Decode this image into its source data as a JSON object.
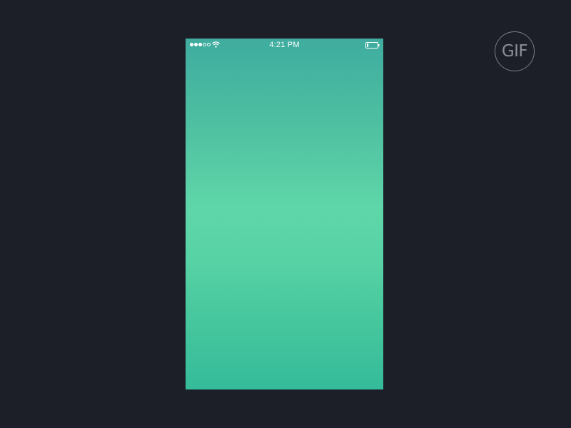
{
  "status_bar": {
    "time": "4:21 PM",
    "signal_bars_filled": 3,
    "signal_bars_total": 5,
    "wifi_icon": "wifi-icon",
    "battery_icon": "battery-icon",
    "battery_level": 0.15
  },
  "badge": {
    "label": "GIF"
  },
  "colors": {
    "background": "#1d1f28",
    "gradient_top": "#3fac9f",
    "gradient_mid": "#5fd6a9",
    "gradient_bottom": "#35bb9a",
    "badge_text": "#8b8e96"
  }
}
